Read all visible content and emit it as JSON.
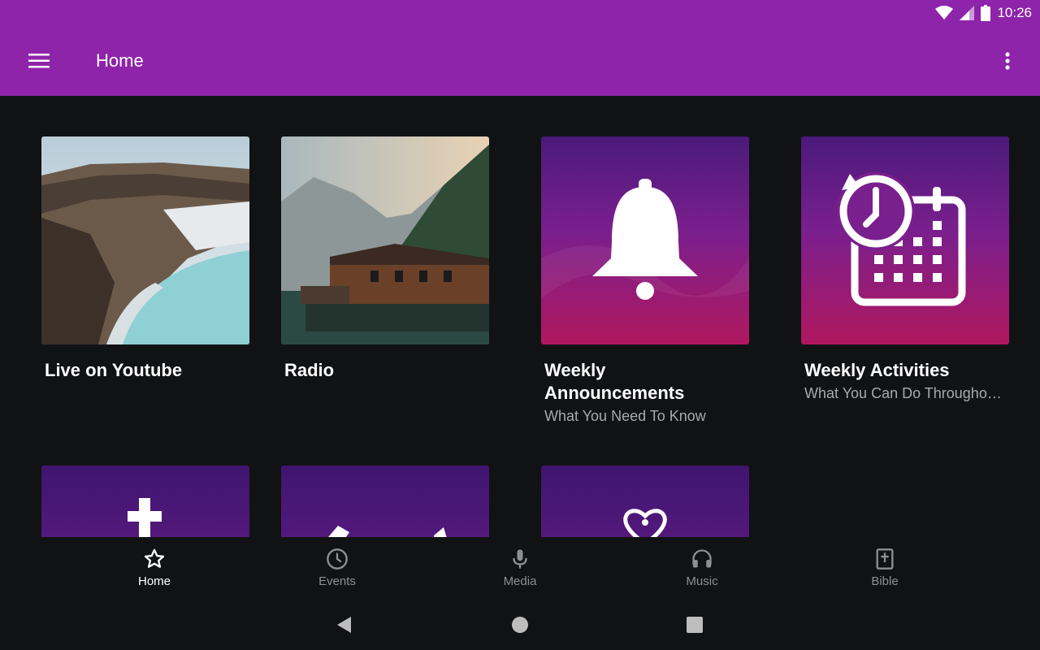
{
  "status_bar": {
    "time": "10:26",
    "icons": [
      "wifi-icon",
      "signal-icon",
      "battery-icon"
    ]
  },
  "app_bar": {
    "title": "Home",
    "menu_icon": "hamburger-menu-icon",
    "overflow_icon": "more-vert-icon"
  },
  "tiles": [
    {
      "title": "Live on Youtube",
      "subtitle": "",
      "image": "crater-lake-photo"
    },
    {
      "title": "Radio",
      "subtitle": "",
      "image": "lake-cabin-photo"
    },
    {
      "title": "Weekly Announcements",
      "subtitle": "What You Need To Know",
      "image": "bell-icon"
    },
    {
      "title": "Weekly Activities",
      "subtitle": "What You Can Do Througho…",
      "image": "calendar-clock-icon"
    },
    {
      "image": "cross-icon"
    },
    {
      "image": "tags-icon"
    },
    {
      "image": "community-heart-icon"
    }
  ],
  "bottom_nav": [
    {
      "label": "Home",
      "icon": "star-icon",
      "active": true
    },
    {
      "label": "Events",
      "icon": "clock-icon",
      "active": false
    },
    {
      "label": "Media",
      "icon": "microphone-icon",
      "active": false
    },
    {
      "label": "Music",
      "icon": "headphones-icon",
      "active": false
    },
    {
      "label": "Bible",
      "icon": "bible-icon",
      "active": false
    }
  ],
  "colors": {
    "primary": "#8E24AA",
    "background": "#111214",
    "subtitle": "#a9a9ad",
    "nav_inactive": "#8f8f93"
  }
}
